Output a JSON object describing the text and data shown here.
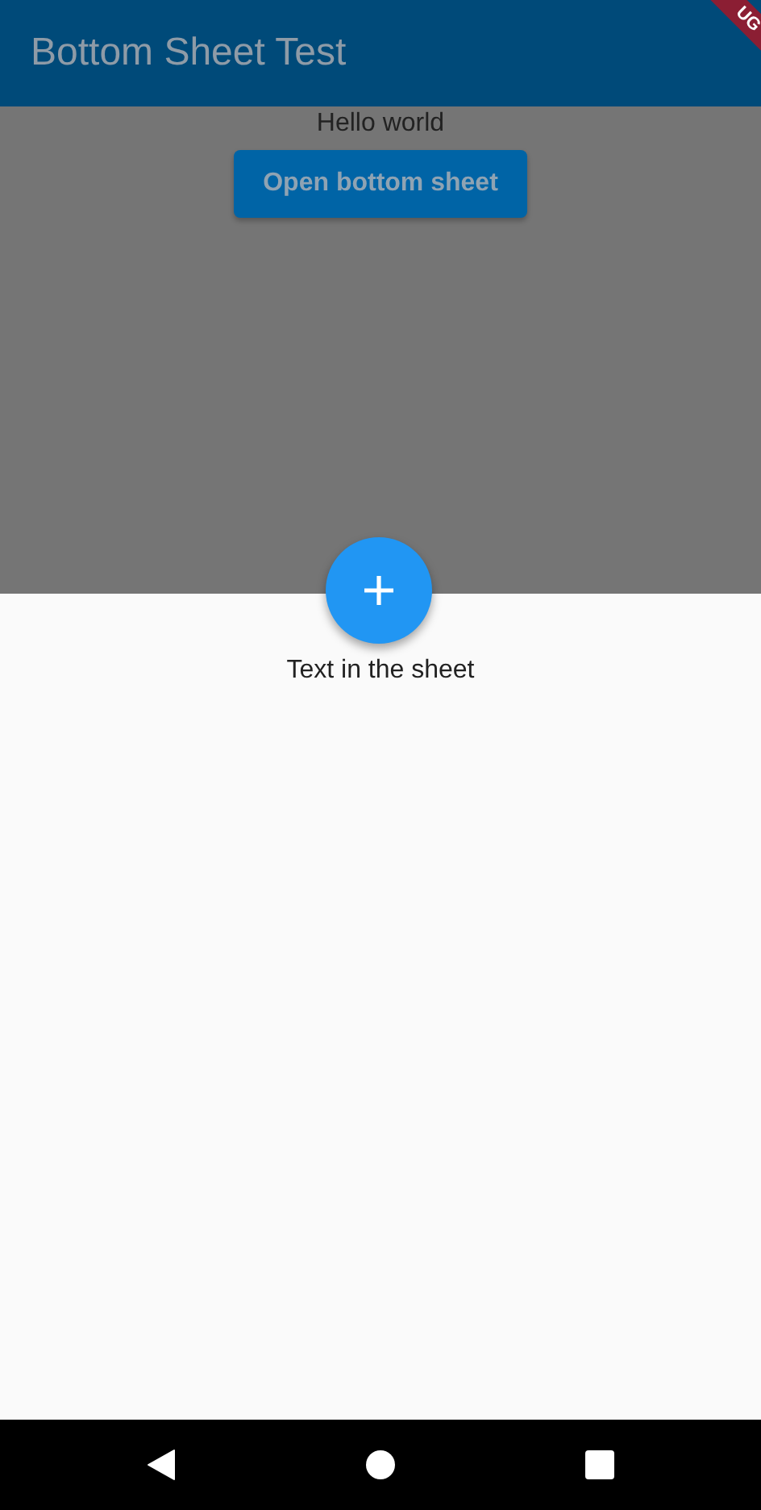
{
  "app_bar": {
    "title": "Bottom Sheet Test"
  },
  "debug_banner": {
    "text": "UG"
  },
  "body": {
    "text": "Hello world",
    "button": "Open bottom sheet"
  },
  "bottom_sheet": {
    "open": true,
    "text": "Text in the sheet"
  }
}
